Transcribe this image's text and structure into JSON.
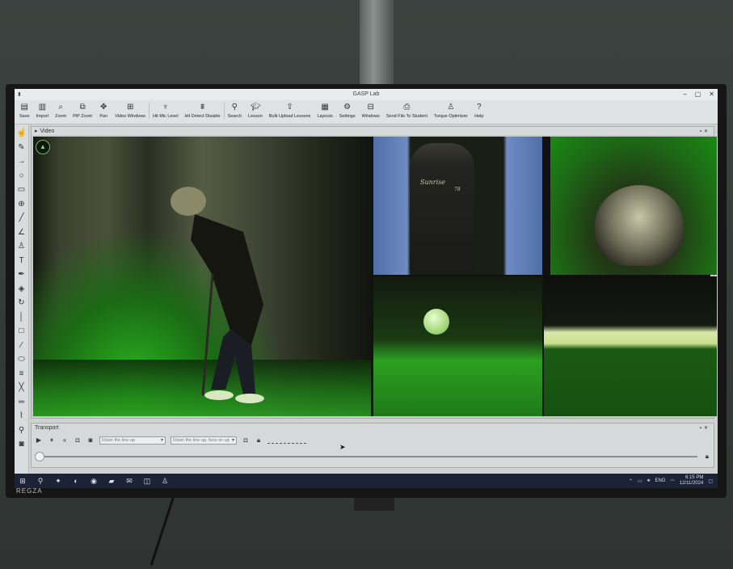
{
  "window": {
    "title": "GASP Lab",
    "controls": [
      "–",
      "▢",
      "✕"
    ]
  },
  "toolbar": {
    "items": [
      {
        "label": "Save",
        "icon": "save-icon"
      },
      {
        "label": "Import",
        "icon": "import-icon"
      },
      {
        "label": "Zoom",
        "icon": "zoom-icon"
      },
      {
        "label": "PiP Zoom",
        "icon": "pip-zoom-icon"
      },
      {
        "label": "Pan",
        "icon": "pan-icon"
      },
      {
        "label": "Video Windows",
        "icon": "video-windows-icon"
      },
      {
        "label": "Hit Mic Level",
        "icon": "mic-icon"
      },
      {
        "label": "Hit Detect Disable",
        "icon": "hit-detect-icon"
      },
      {
        "label": "Search",
        "icon": "search-icon"
      },
      {
        "label": "Lesson",
        "icon": "lesson-icon"
      },
      {
        "label": "Bulk Upload Lessons",
        "icon": "bulk-upload-icon"
      },
      {
        "label": "Layouts",
        "icon": "layouts-icon"
      },
      {
        "label": "Settings",
        "icon": "settings-icon"
      },
      {
        "label": "Windows",
        "icon": "windows-icon"
      },
      {
        "label": "Send File To Student",
        "icon": "send-file-icon"
      },
      {
        "label": "Torque Optimizer",
        "icon": "torque-icon"
      },
      {
        "label": "Help",
        "icon": "help-icon"
      }
    ]
  },
  "video_panel": {
    "title": "Video",
    "overlay_text": "Sunrise",
    "overlay_number": "78"
  },
  "transport": {
    "title": "Transport",
    "camera_view_1": "Down the line up",
    "camera_view_2": "Down the line up, face on up"
  },
  "taskbar": {
    "language": "ENG",
    "time": "6:15 PM",
    "date": "12/11/2024"
  },
  "monitor": {
    "brand": "REGZA"
  }
}
